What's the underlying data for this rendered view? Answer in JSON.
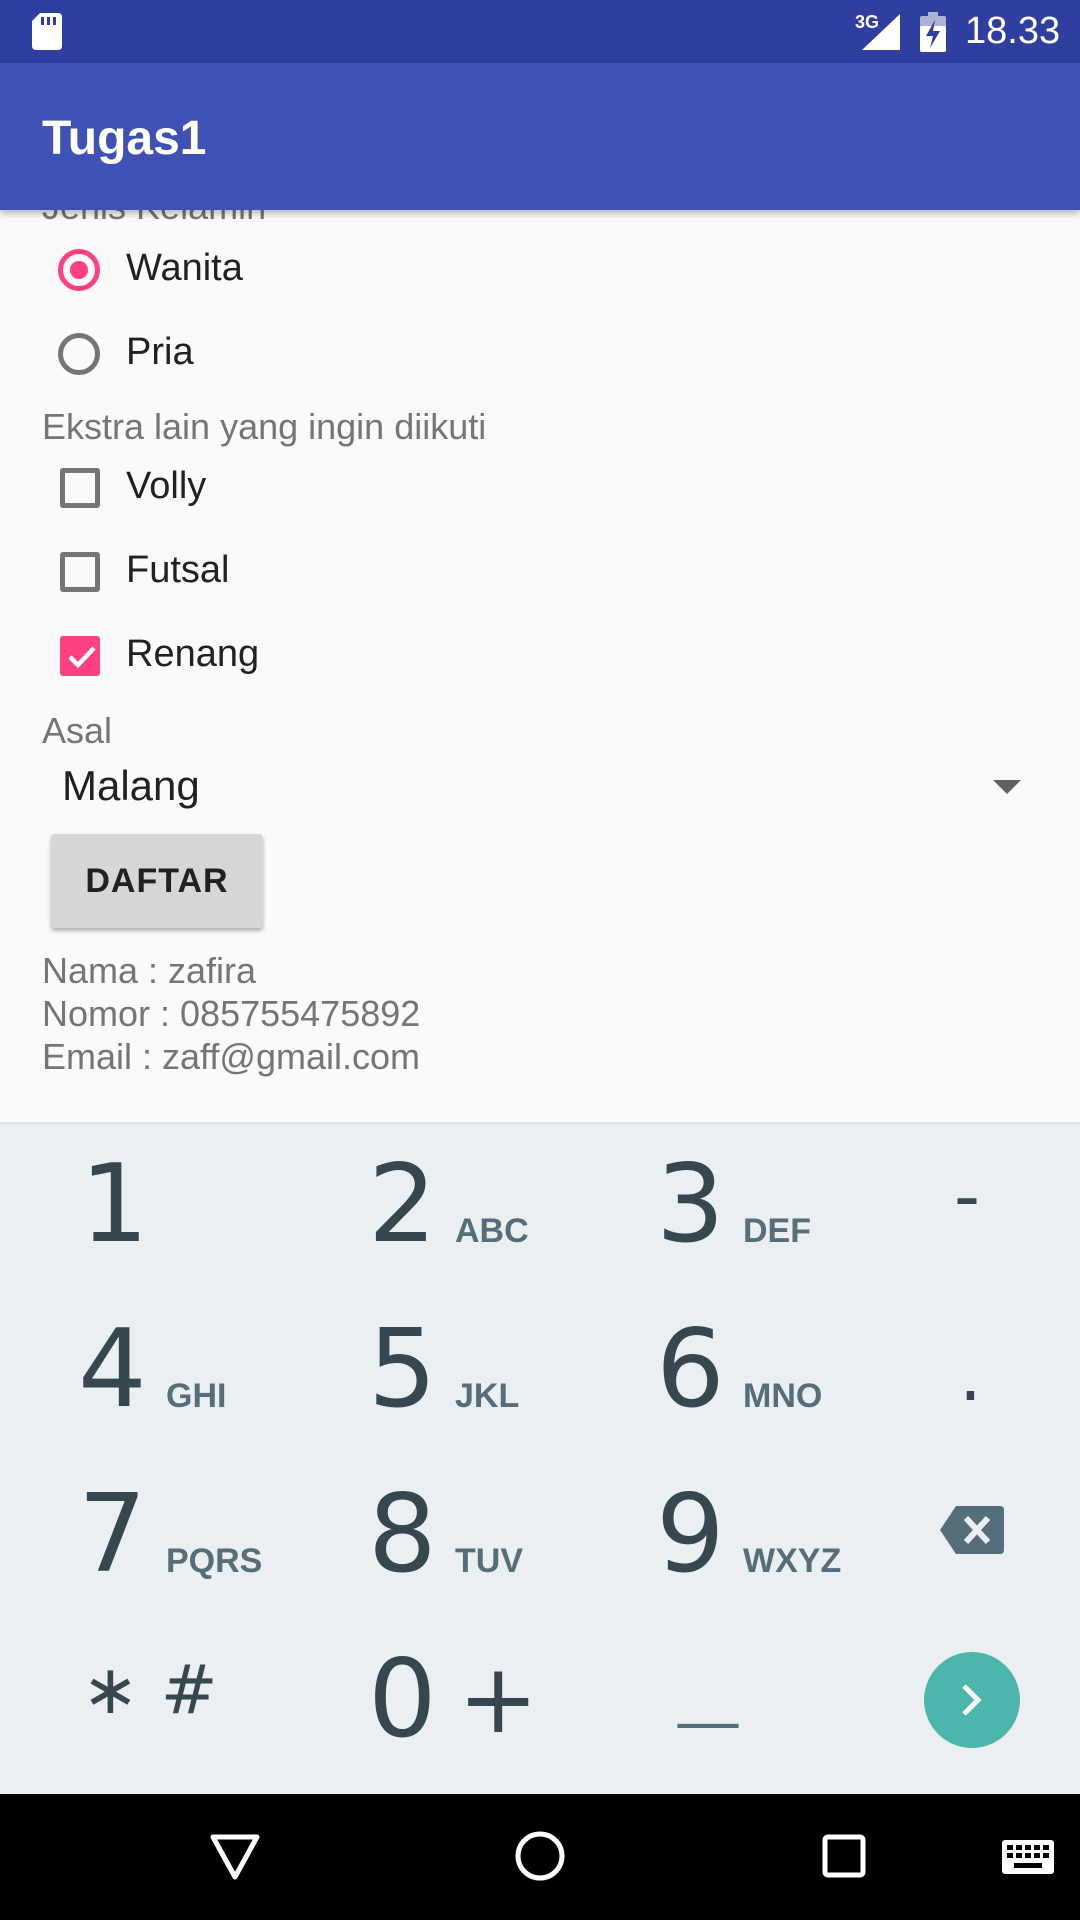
{
  "status_bar": {
    "network": "3G",
    "time": "18.33",
    "icons": [
      "sd-card-icon",
      "signal-icon",
      "battery-charging-icon"
    ]
  },
  "app_bar": {
    "title": "Tugas1"
  },
  "form": {
    "gender_label": "Jenis Kelamin",
    "gender_options": [
      {
        "label": "Wanita",
        "checked": true
      },
      {
        "label": "Pria",
        "checked": false
      }
    ],
    "extras_label": "Ekstra lain yang ingin diikuti",
    "extras_options": [
      {
        "label": "Volly",
        "checked": false
      },
      {
        "label": "Futsal",
        "checked": false
      },
      {
        "label": "Renang",
        "checked": true
      }
    ],
    "origin_label": "Asal",
    "origin_value": "Malang",
    "submit_label": "DAFTAR"
  },
  "result": {
    "name_line": "Nama : zafira",
    "phone_line": "Nomor : 085755475892",
    "email_line": "Email : zaff@gmail.com"
  },
  "keyboard": {
    "keys": [
      {
        "num": "1",
        "letters": ""
      },
      {
        "num": "2",
        "letters": "ABC"
      },
      {
        "num": "3",
        "letters": "DEF"
      },
      {
        "num": "-",
        "letters": ""
      },
      {
        "num": "4",
        "letters": "GHI"
      },
      {
        "num": "5",
        "letters": "JKL"
      },
      {
        "num": "6",
        "letters": "MNO"
      },
      {
        "num": ".",
        "letters": ""
      },
      {
        "num": "7",
        "letters": "PQRS"
      },
      {
        "num": "8",
        "letters": "TUV"
      },
      {
        "num": "9",
        "letters": "WXYZ"
      }
    ],
    "star_hash": "∗ #",
    "zero": "0",
    "plus": "+",
    "space": "__"
  },
  "colors": {
    "status_bar": "#303f9f",
    "app_bar": "#3f51b5",
    "accent": "#ff4081",
    "keyboard_bg": "#eceff1",
    "go_button": "#4db6ac"
  }
}
